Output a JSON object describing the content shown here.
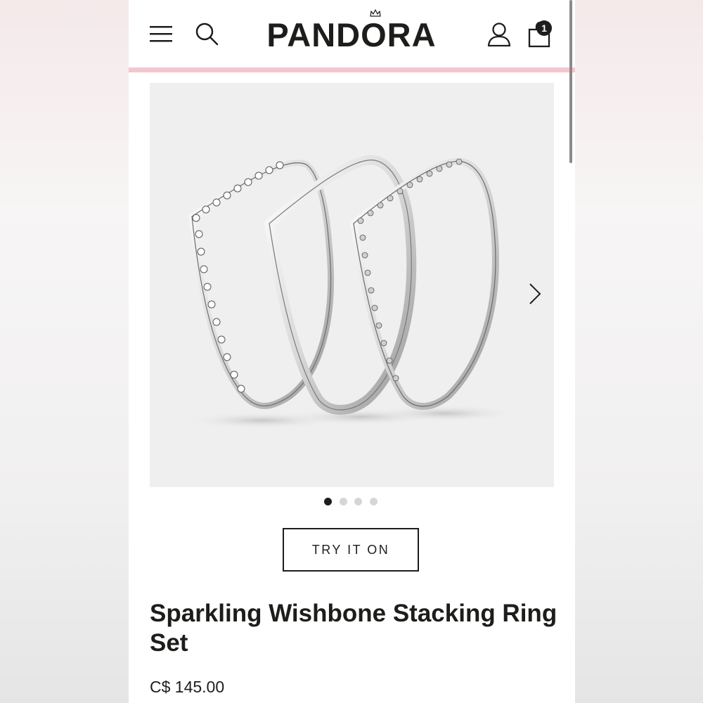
{
  "header": {
    "logo_text": "PANDORA",
    "cart_count": "1",
    "icons": [
      "menu-icon",
      "search-icon",
      "account-icon",
      "shopping-bag-icon",
      "crown-icon"
    ]
  },
  "colors": {
    "accent_pink": "#f4c6d0",
    "text_dark": "#1d1d1b",
    "gallery_bg": "#efefef"
  },
  "gallery": {
    "image_count": 4,
    "active_index": 0
  },
  "product": {
    "try_on_label": "TRY IT ON",
    "title": "Sparkling Wishbone Stacking Ring Set",
    "price": "C$ 145.00"
  }
}
